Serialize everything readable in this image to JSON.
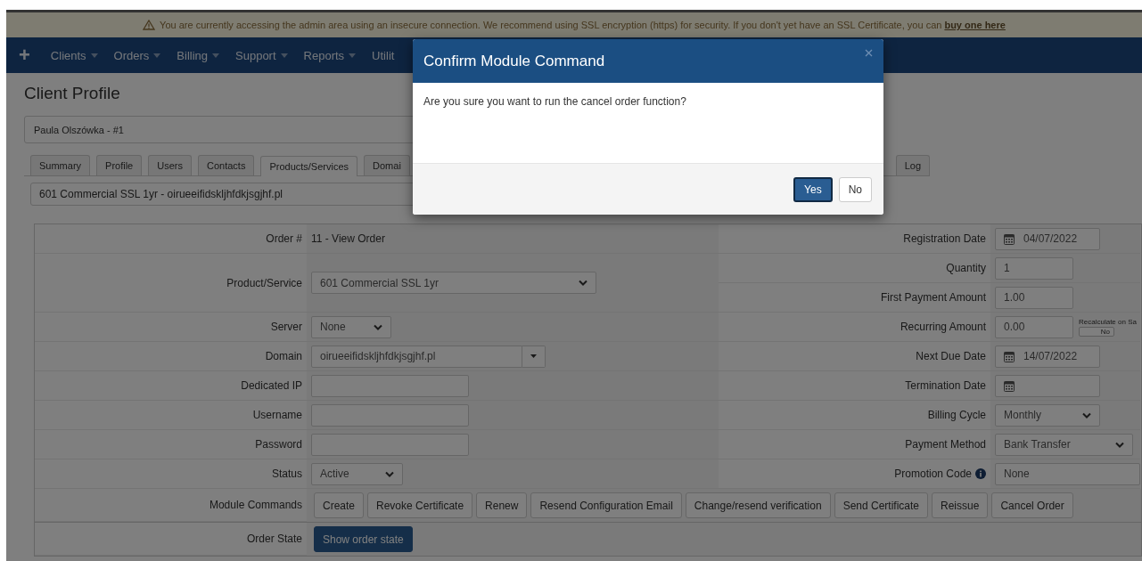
{
  "alert": {
    "text": "You are currently accessing the admin area using an insecure connection. We recommend using SSL encryption (https) for security. If you don't yet have an SSL Certificate, you can ",
    "link": "buy one here"
  },
  "nav": [
    {
      "label": "+",
      "caret": false
    },
    {
      "label": "Clients",
      "caret": true
    },
    {
      "label": "Orders",
      "caret": true
    },
    {
      "label": "Billing",
      "caret": true
    },
    {
      "label": "Support",
      "caret": true
    },
    {
      "label": "Reports",
      "caret": true
    },
    {
      "label": "Utilit",
      "caret": false
    }
  ],
  "page_title": "Client Profile",
  "client_select": "Paula Olszówka - #1",
  "tabs": [
    {
      "label": "Summary",
      "selected": false
    },
    {
      "label": "Profile",
      "selected": false
    },
    {
      "label": "Users",
      "selected": false
    },
    {
      "label": "Contacts",
      "selected": false
    },
    {
      "label": "Products/Services",
      "selected": true
    },
    {
      "label": "Domai",
      "selected": false
    },
    {
      "label": "Log",
      "selected": false
    }
  ],
  "service_select": "601 Commercial SSL 1yr - oirueeifidskljhfdkjsgjhf.pl",
  "form": {
    "left": [
      {
        "label": "Order #",
        "kind": "text",
        "value": "11 - View Order"
      },
      {
        "label": "Product/Service",
        "kind": "select",
        "value": "601 Commercial SSL 1yr"
      },
      {
        "label": "Server",
        "kind": "select",
        "value": "None"
      },
      {
        "label": "Domain",
        "kind": "combo",
        "value": "oirueeifidskljhfdkjsgjhf.pl"
      },
      {
        "label": "Dedicated IP",
        "kind": "input"
      },
      {
        "label": "Username",
        "kind": "input"
      },
      {
        "label": "Password",
        "kind": "input"
      },
      {
        "label": "Status",
        "kind": "select",
        "value": "Active"
      }
    ],
    "right": [
      {
        "label": "Registration Date",
        "kind": "date",
        "value": "04/07/2022"
      },
      {
        "label": "Quantity",
        "kind": "input",
        "value": "1"
      },
      {
        "label": "First Payment Amount",
        "kind": "input",
        "value": "1.00"
      },
      {
        "label": "Recurring Amount",
        "kind": "input",
        "value": "0.00",
        "recalc": {
          "label": "Recalculate on Sa",
          "toggle": "No",
          "on": false
        }
      },
      {
        "label": "Next Due Date",
        "kind": "date",
        "value": "14/07/2022"
      },
      {
        "label": "Termination Date",
        "kind": "date"
      },
      {
        "label": "Billing Cycle",
        "kind": "select",
        "value": "Monthly"
      },
      {
        "label": "Payment Method",
        "kind": "select",
        "value": "Bank Transfer"
      },
      {
        "label": "Promotion Code",
        "kind": "input",
        "value": "None",
        "info": true
      }
    ],
    "module_commands": {
      "label": "Module Commands",
      "buttons": [
        "Create",
        "Revoke Certificate",
        "Renew",
        "Resend Configuration Email",
        "Change/resend verification",
        "Send Certificate",
        "Reissue",
        "Cancel Order"
      ]
    },
    "order_state": {
      "label": "Order State",
      "button": "Show order state"
    }
  },
  "modal": {
    "title": "Confirm Module Command",
    "message": "Are you sure you want to run the cancel order function?",
    "buttons": [
      {
        "label": "Yes",
        "kind": "primary"
      },
      {
        "label": "No",
        "kind": "default"
      }
    ]
  }
}
